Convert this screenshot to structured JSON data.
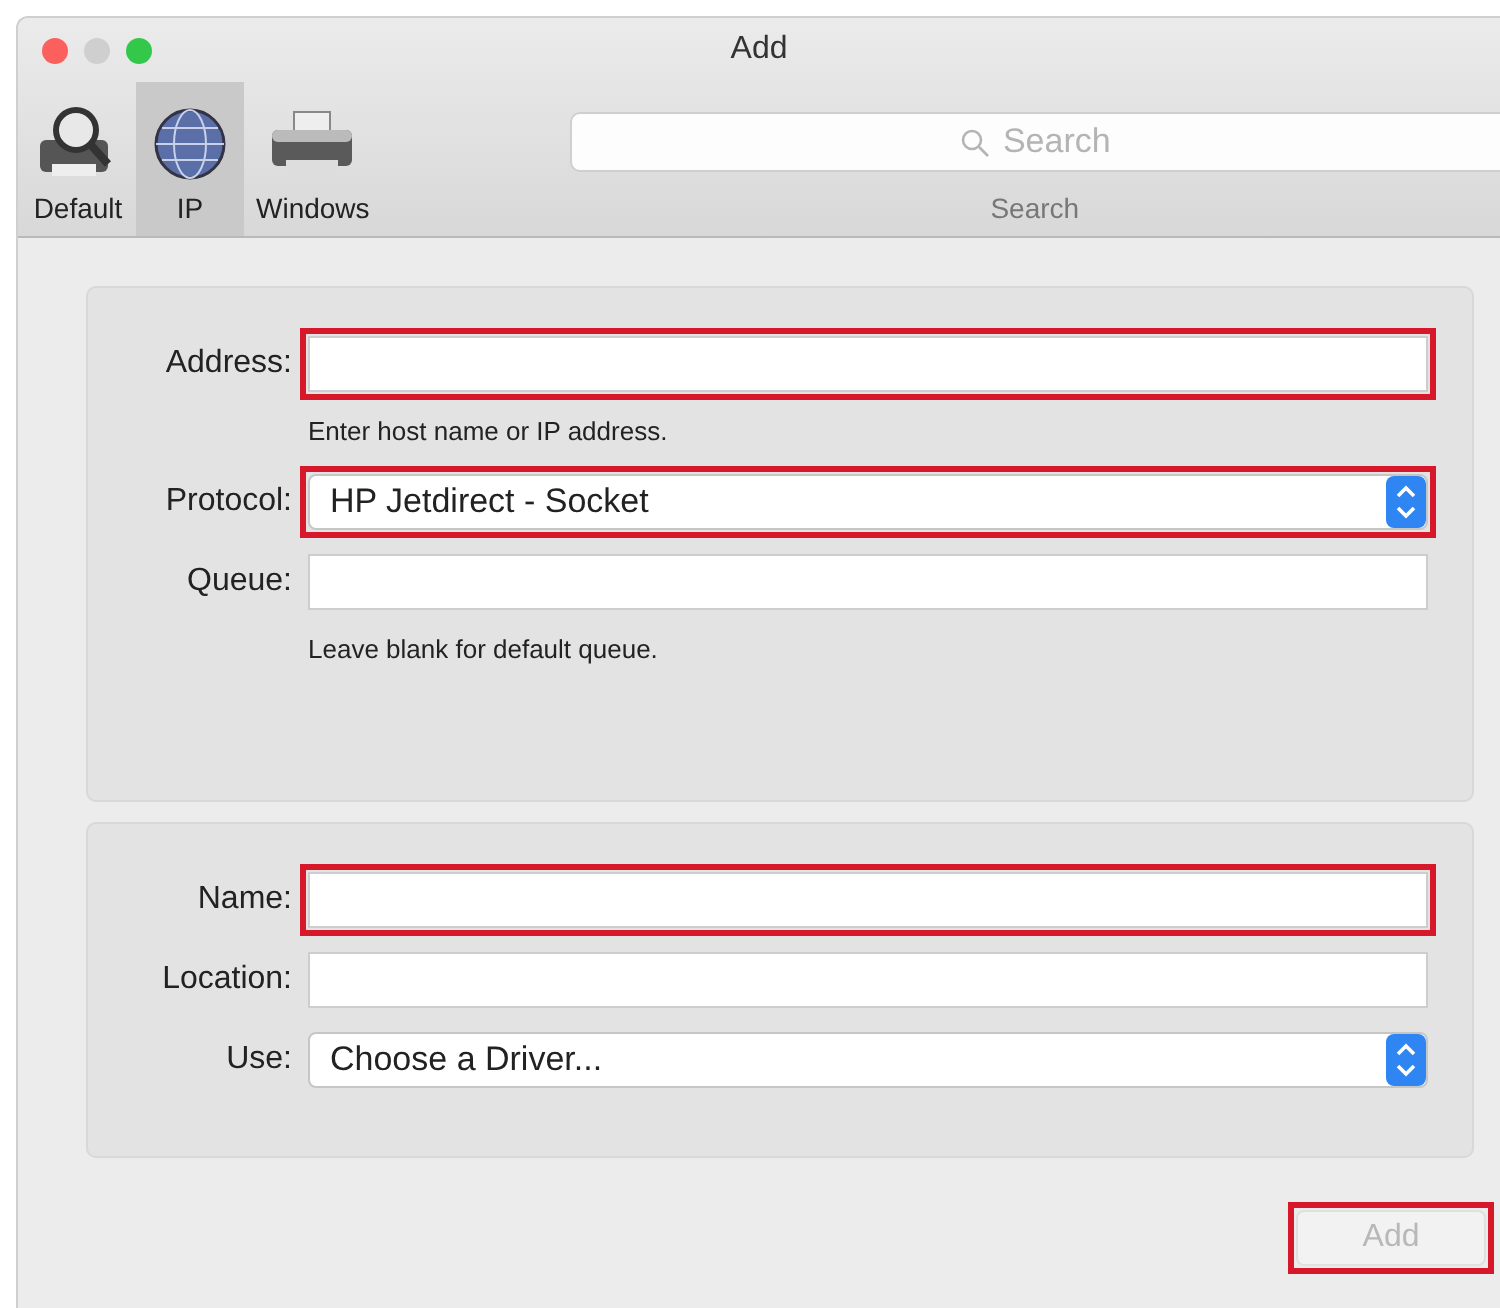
{
  "window": {
    "title": "Add"
  },
  "toolbar": {
    "items": [
      {
        "label": "Default",
        "kind": "default",
        "selected": false
      },
      {
        "label": "IP",
        "kind": "ip",
        "selected": true
      },
      {
        "label": "Windows",
        "kind": "windows",
        "selected": false
      }
    ],
    "search": {
      "placeholder": "Search",
      "label": "Search"
    }
  },
  "sections": [
    {
      "fields": [
        {
          "kind": "text",
          "label": "Address:",
          "highlighted": true,
          "hint": "Enter host name or IP address."
        },
        {
          "kind": "select",
          "label": "Protocol:",
          "value": "HP Jetdirect - Socket",
          "highlighted": true
        },
        {
          "kind": "text",
          "label": "Queue:",
          "highlighted": false,
          "hint": "Leave blank for default queue."
        }
      ]
    },
    {
      "fields": [
        {
          "kind": "text",
          "label": "Name:",
          "highlighted": true
        },
        {
          "kind": "text",
          "label": "Location:",
          "highlighted": false
        },
        {
          "kind": "select",
          "label": "Use:",
          "value": "Choose a Driver...",
          "highlighted": false
        }
      ]
    }
  ],
  "add_button": {
    "label": "Add",
    "disabled": true,
    "highlighted": true
  }
}
